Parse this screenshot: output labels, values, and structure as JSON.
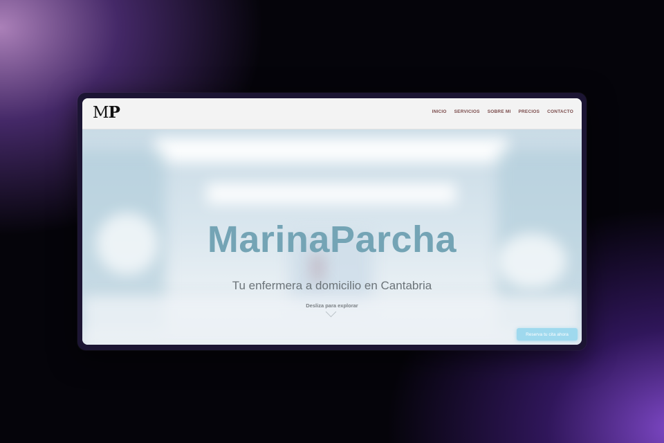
{
  "logo": {
    "m": "M",
    "p": "P"
  },
  "nav": {
    "items": [
      "INICIO",
      "SERVICIOS",
      "SOBRE MI",
      "PRECIOS",
      "CONTACTO"
    ]
  },
  "hero": {
    "title": "MarinaParcha",
    "tagline": "Tu enfermera a domicilio en Cantabria",
    "scroll_hint": "Desliza para explorar",
    "cta_label": "Reserva tu cita ahora"
  },
  "colors": {
    "title": "#74a4b5",
    "nav_text": "#7a4a4a",
    "cta": "#9fd9ee"
  }
}
